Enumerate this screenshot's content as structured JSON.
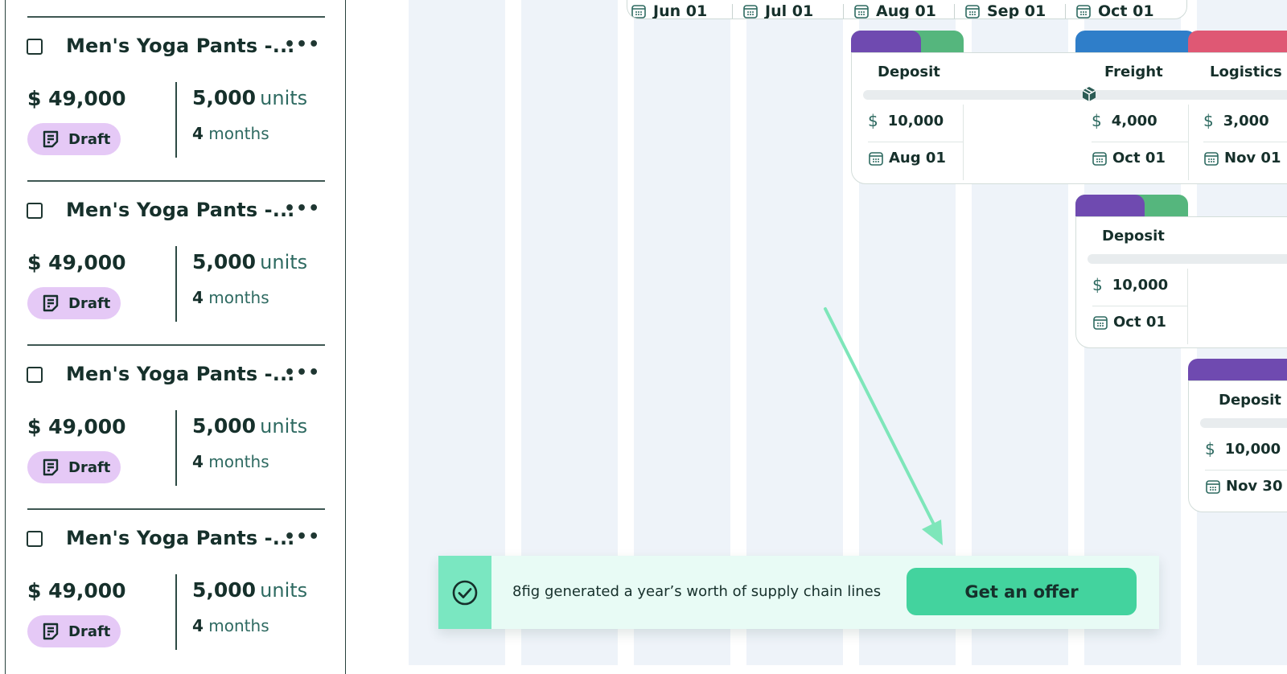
{
  "sidebar": {
    "items": [
      {
        "name": "Men's Yoga Pants -...",
        "price": "$ 49,000",
        "units_value": "5,000",
        "units_label": "units",
        "duration_value": "4",
        "duration_label": "months",
        "status": "Draft"
      },
      {
        "name": "Men's Yoga Pants -...",
        "price": "$ 49,000",
        "units_value": "5,000",
        "units_label": "units",
        "duration_value": "4",
        "duration_label": "months",
        "status": "Draft"
      },
      {
        "name": "Men's Yoga Pants -...",
        "price": "$ 49,000",
        "units_value": "5,000",
        "units_label": "units",
        "duration_value": "4",
        "duration_label": "months",
        "status": "Draft"
      },
      {
        "name": "Men's Yoga Pants -...",
        "price": "$ 49,000",
        "units_value": "5,000",
        "units_label": "units",
        "duration_value": "4",
        "duration_label": "months",
        "status": "Draft"
      }
    ],
    "more_label": "•••",
    "status_icon": "note-icon",
    "status_color": "#e5c9f6"
  },
  "timeline": {
    "top_card_dates": [
      "Jun 01",
      "Jul 01",
      "Aug 01",
      "Sep 01",
      "Oct 01"
    ],
    "row1": {
      "deposit": {
        "title": "Deposit",
        "currency": "$",
        "amount": "10,000",
        "date": "Aug 01"
      },
      "freight": {
        "title": "Freight",
        "currency": "$",
        "amount": "4,000",
        "date": "Oct 01"
      },
      "logistics": {
        "title": "Logistics",
        "currency": "$",
        "amount": "3,000",
        "date": "Nov 01"
      }
    },
    "row2": {
      "deposit": {
        "title": "Deposit",
        "currency": "$",
        "amount": "10,000",
        "date": "Oct 01"
      }
    },
    "row3": {
      "deposit": {
        "title": "Deposit",
        "currency": "$",
        "amount": "10,000",
        "date": "Nov 30"
      }
    },
    "colors": {
      "deposit_tab": "#6f4ab0",
      "deposit_tab_secondary": "#55b67d",
      "freight_tab": "#2f7ec9",
      "logistics_tab": "#df5874",
      "column_bg": "#eef3f9",
      "arrow": "#7ee6ba"
    }
  },
  "notification": {
    "message": "8fig generated a year’s worth of supply chain lines",
    "button_label": "Get an offer",
    "icon": "check-circle-icon",
    "accent": "#43d39e"
  }
}
